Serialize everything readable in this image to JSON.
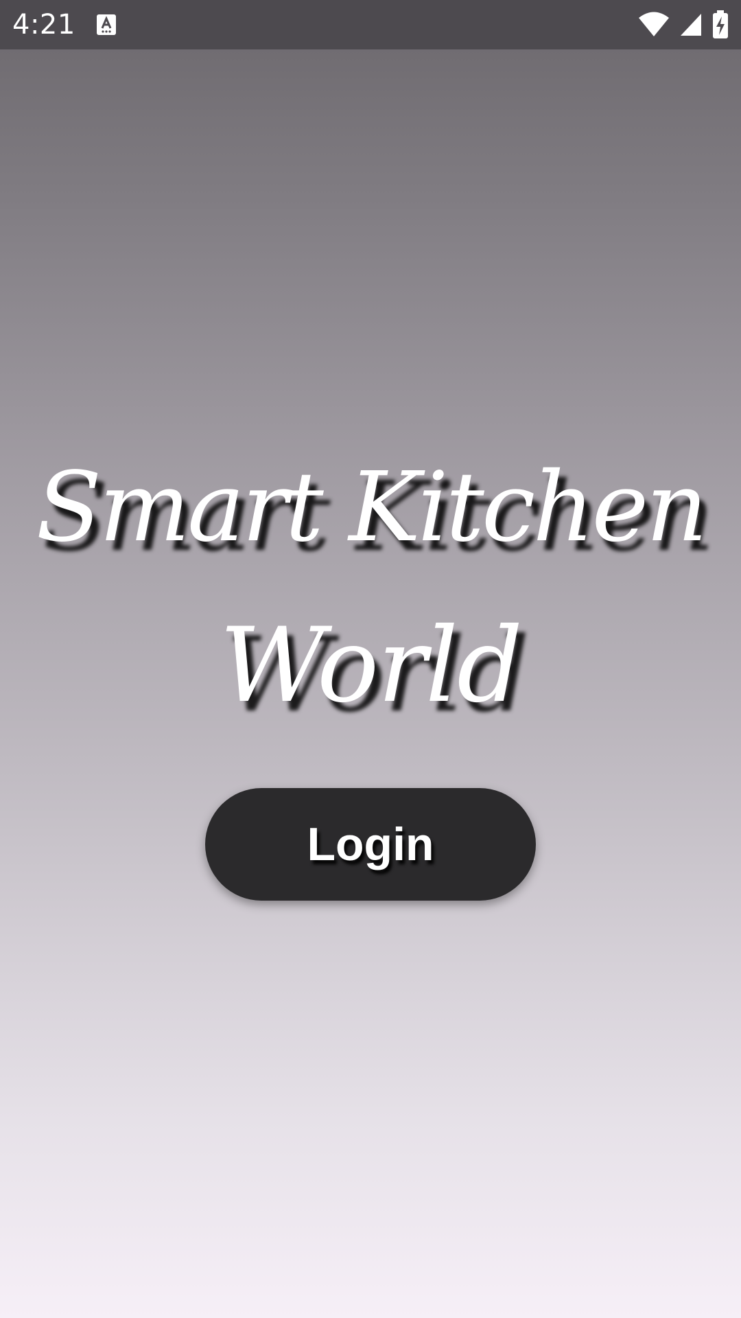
{
  "status_bar": {
    "time": "4:21",
    "icons": [
      "keyboard-app-icon",
      "wifi-icon",
      "cellular-signal-icon",
      "battery-charging-icon"
    ]
  },
  "title": {
    "line1": "Smart Kitchen",
    "line2": "World"
  },
  "login_button": {
    "label": "Login"
  },
  "colors": {
    "status_bar_bg": "#4d4a4f",
    "gradient_top": "#6b676c",
    "gradient_bottom": "#f6eff7",
    "button_bg": "#2b2a2c",
    "text": "#ffffff"
  }
}
